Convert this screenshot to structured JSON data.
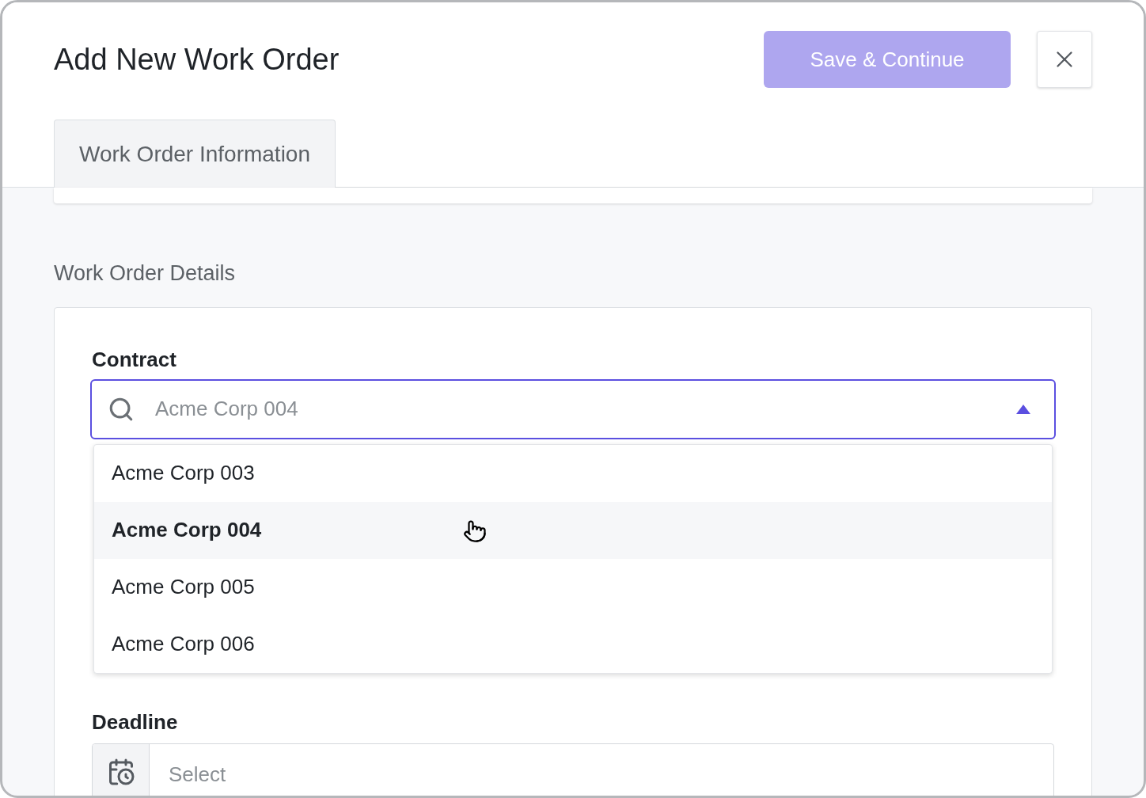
{
  "window": {
    "title": "Add New Work Order"
  },
  "save_button": {
    "label": "Save & Continue",
    "disabled": true
  },
  "tabs": [
    {
      "label": "Work Order Information",
      "selected": true
    }
  ],
  "section": {
    "title": "Work Order Details"
  },
  "fields": [
    {
      "kind": "combobox",
      "label": "Contract",
      "placeholder": "Acme Corp 004",
      "expanded": true,
      "options": [
        {
          "label": "Acme Corp 003",
          "selected": false
        },
        {
          "label": "Acme Corp 004",
          "selected": true
        },
        {
          "label": "Acme Corp 005",
          "selected": false
        },
        {
          "label": "Acme Corp 006",
          "selected": false
        }
      ]
    },
    {
      "kind": "date",
      "label": "Deadline",
      "placeholder": "Select"
    }
  ]
}
